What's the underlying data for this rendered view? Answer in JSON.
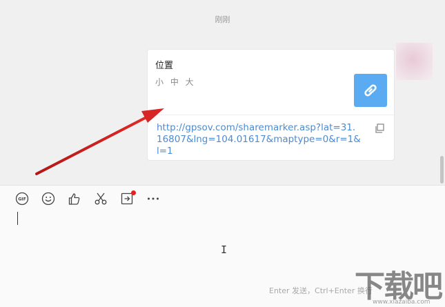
{
  "chat": {
    "timestamp": "刚刚",
    "message": {
      "title": "位置",
      "sizes": "小 中 大",
      "url": "http://gpsov.com/sharemarker.asp?lat=31.16807&lng=104.01617&maptype=0&r=1&l=1"
    }
  },
  "toolbar": {
    "items": [
      "gif-icon",
      "emoji-icon",
      "thumbs-up-icon",
      "scissors-icon",
      "share-screen-icon",
      "more-icon"
    ]
  },
  "input": {
    "send_hint": "Enter 发送，Ctrl+Enter 换行"
  },
  "watermark": {
    "text": "下载吧",
    "subtext": "www.xiazaiba.com"
  },
  "colors": {
    "accent": "#5aabf2",
    "link": "#4b8bd0",
    "annotation_arrow": "#cc1f1f"
  }
}
